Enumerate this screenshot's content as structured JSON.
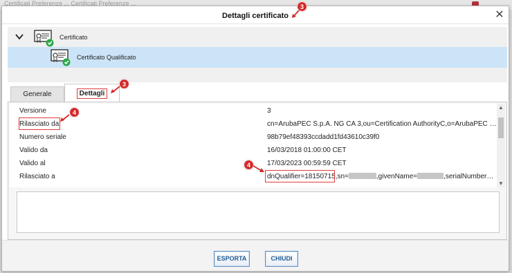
{
  "dialog": {
    "title": "Dettagli certificato"
  },
  "background": {
    "fragment": "Certificati   Preferenze   ...   Certificati   Preferenze   ..."
  },
  "tree": {
    "root_label": "Certificato",
    "child_label": "Certificato Qualificato"
  },
  "tabs": [
    {
      "label": "Generale",
      "active": false
    },
    {
      "label": "Dettagli",
      "active": true
    }
  ],
  "fields": [
    {
      "name": "Versione",
      "value": "3"
    },
    {
      "name": "Rilasciato da",
      "value": "cn=ArubaPEC S.p.A. NG CA 3,ou=Certification AuthorityC,o=ArubaPEC S.p.A."
    },
    {
      "name": "Numero seriale",
      "value": "98b79ef48393ccdadd1fd43610c39f0"
    },
    {
      "name": "Valido da",
      "value": "16/03/2018 01:00:00 CET"
    },
    {
      "name": "Valido al",
      "value": "17/03/2023 00:59:59 CET"
    },
    {
      "name": "Rilasciato a",
      "value_parts": {
        "highlighted": "dnQualifier=18150715",
        "sn_label": ",sn=",
        "given_label": ",givenName=",
        "serial_label": ",serialNumber=TI..."
      }
    }
  ],
  "buttons": {
    "export": "ESPORTA",
    "close": "CHIUDI"
  },
  "annotations": {
    "title_badge": "3",
    "tab_badge": "3",
    "field_badge": "4",
    "value_badge": "4"
  },
  "colors": {
    "accent": "#1f5a96",
    "selection": "#cce4f7",
    "annotation": "#e23b3b"
  },
  "icons": {
    "certificate": "certificate-verified-icon",
    "expand": "chevron-down-icon",
    "close": "close-icon"
  }
}
